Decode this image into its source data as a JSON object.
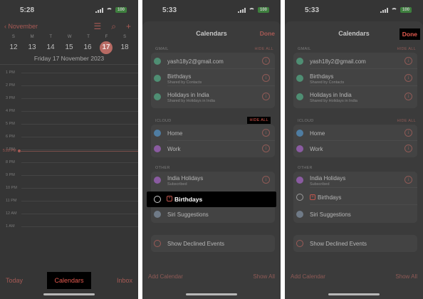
{
  "s1": {
    "time": "5:28",
    "battery": "100",
    "back_label": "November",
    "dow": [
      "S",
      "M",
      "T",
      "W",
      "T",
      "F",
      "S"
    ],
    "days": [
      "12",
      "13",
      "14",
      "15",
      "16",
      "17",
      "18"
    ],
    "date_label": "Friday   17 November 2023",
    "hours": [
      "1 PM",
      "2 PM",
      "3 PM",
      "4 PM",
      "5 PM",
      "6 PM",
      "7 PM",
      "8 PM",
      "9 PM",
      "10 PM",
      "11 PM",
      "12 AM",
      "1 AM"
    ],
    "now_label": "5:28 PM",
    "today": "Today",
    "calendars": "Calendars",
    "inbox": "Inbox"
  },
  "s2": {
    "time": "5:33",
    "battery": "100",
    "title": "Calendars",
    "done": "Done",
    "gmail_header": "GMAIL",
    "gmail_hide": "HIDE ALL",
    "gmail_rows": [
      {
        "label": "yash18y2@gmail.com",
        "sub": ""
      },
      {
        "label": "Birthdays",
        "sub": "Shared by Contacts"
      },
      {
        "label": "Holidays in India",
        "sub": "Shared by Holidays in India"
      }
    ],
    "icloud_header": "ICLOUD",
    "icloud_hide": "HIDE ALL",
    "icloud_rows": [
      "Home",
      "Work"
    ],
    "other_header": "OTHER",
    "other_rows": [
      {
        "label": "India Holidays",
        "sub": "Subscribed"
      },
      {
        "label": "Birthdays",
        "sub": ""
      },
      {
        "label": "Siri Suggestions",
        "sub": ""
      }
    ],
    "declined": "Show Declined Events",
    "add_calendar": "Add Calendar",
    "show_all": "Show All"
  },
  "s3": {
    "time": "5:33",
    "battery": "100",
    "title": "Calendars",
    "done": "Done",
    "gmail_header": "GMAIL",
    "gmail_hide": "HIDE ALL",
    "gmail_rows": [
      {
        "label": "yash18y2@gmail.com",
        "sub": ""
      },
      {
        "label": "Birthdays",
        "sub": "Shared by Contacts"
      },
      {
        "label": "Holidays in India",
        "sub": "Shared by Holidays in India"
      }
    ],
    "icloud_header": "ICLOUD",
    "icloud_hide": "HIDE ALL",
    "icloud_rows": [
      "Home",
      "Work"
    ],
    "other_header": "OTHER",
    "other_rows": [
      {
        "label": "India Holidays",
        "sub": "Subscribed"
      },
      {
        "label": "Birthdays",
        "sub": ""
      },
      {
        "label": "Siri Suggestions",
        "sub": ""
      }
    ],
    "declined": "Show Declined Events",
    "add_calendar": "Add Calendar",
    "show_all": "Show All"
  },
  "icons": {
    "back": "chevron-left-icon",
    "list": "list-icon",
    "search": "search-icon",
    "add": "plus-icon",
    "info": "info-icon",
    "birthday": "gift-icon"
  },
  "colors": {
    "accent": "#e45a4f",
    "gmail": "#4f8e73",
    "home": "#4f7da2",
    "work": "#8a5ba1",
    "siri": "#6f7a87"
  }
}
